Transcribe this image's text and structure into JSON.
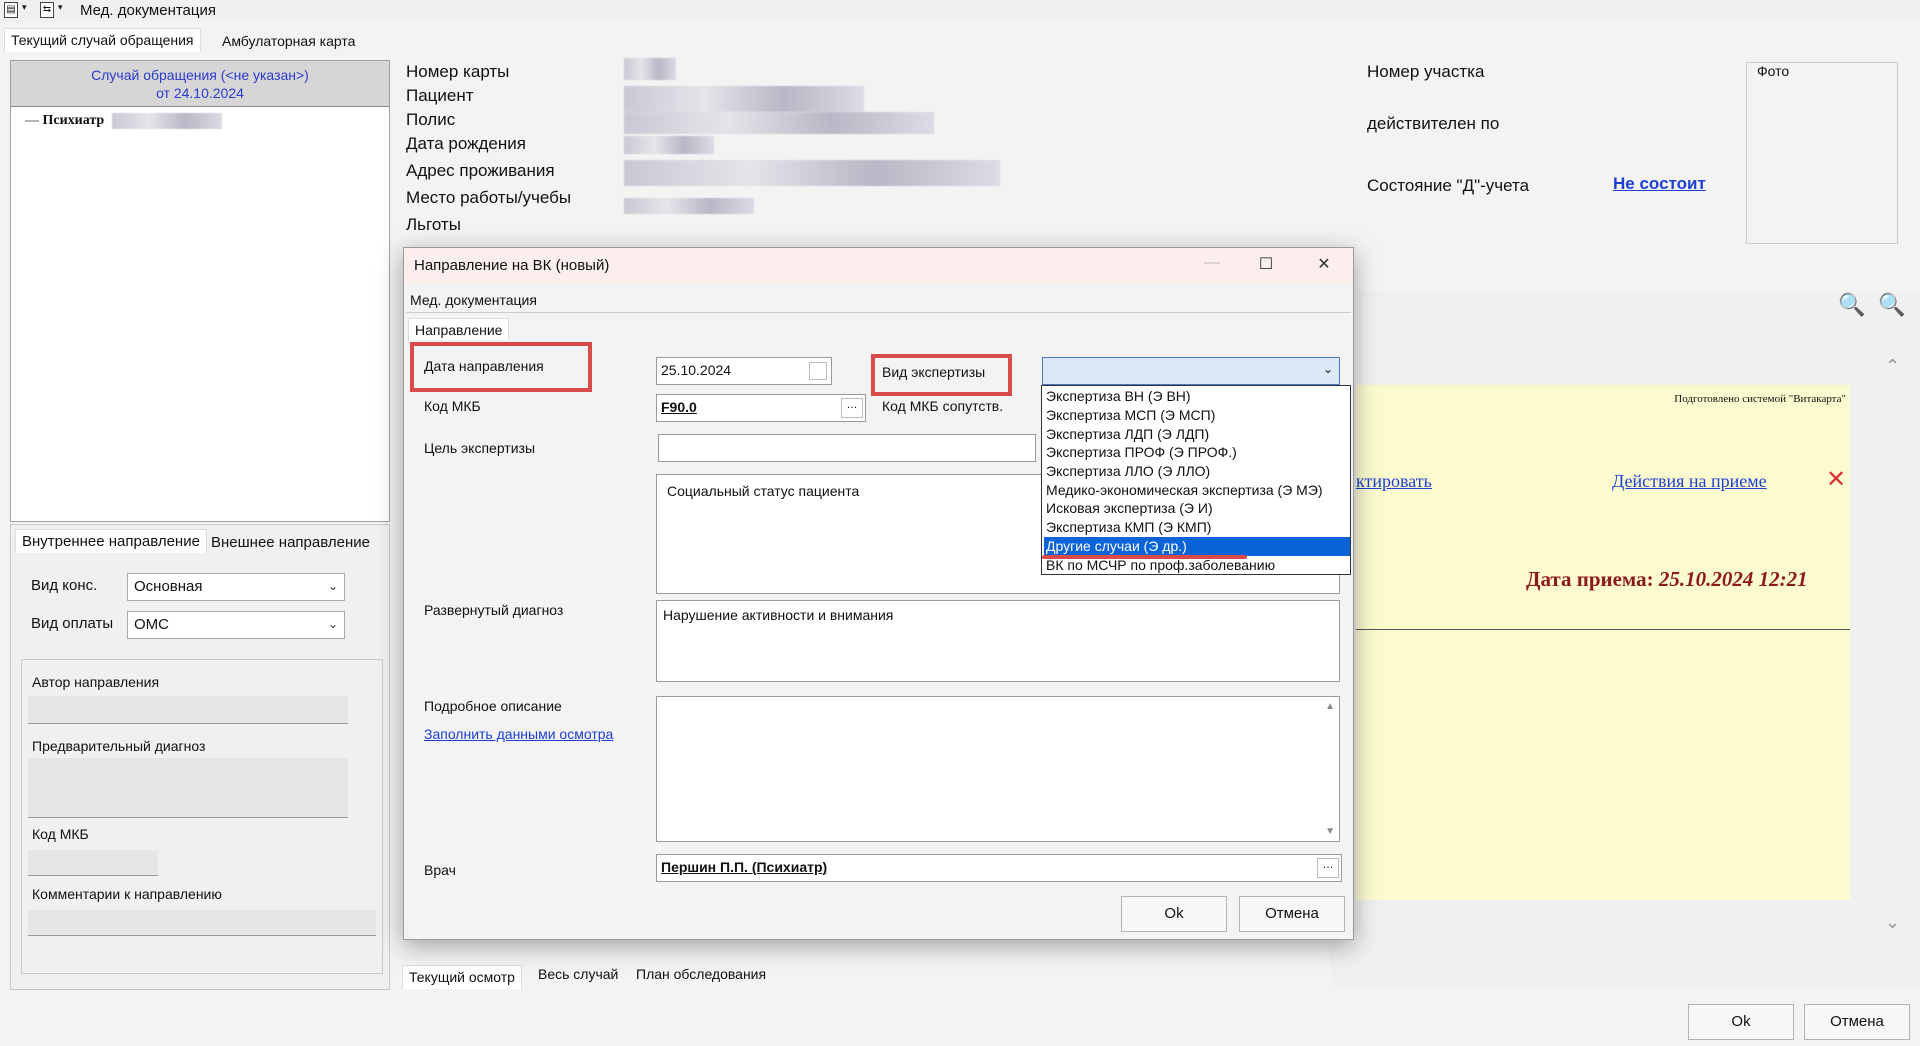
{
  "app": {
    "title": "Мед. документация",
    "tabs": [
      "Текущий случай обращения",
      "Амбулаторная карта"
    ]
  },
  "case": {
    "line1": "Случай обращения (<не указан>)",
    "line2": "от 24.10.2024",
    "tree_item": "Психиатр"
  },
  "left_bottom": {
    "tabs": [
      "Внутреннее направление",
      "Внешнее направление"
    ],
    "vid_kons_label": "Вид конс.",
    "vid_kons_value": "Основная",
    "vid_oplaty_label": "Вид оплаты",
    "vid_oplaty_value": "ОМС",
    "author_label": "Автор направления",
    "prelim_diag_label": "Предварительный диагноз",
    "mkb_label": "Код МКБ",
    "comments_label": "Комментарии к направлению"
  },
  "patient": {
    "labels": [
      "Номер карты",
      "Пациент",
      "Полис",
      "Дата рождения",
      "Адрес проживания",
      "Место работы/учебы",
      "Льготы"
    ],
    "uchastok_label": "Номер участка",
    "valid_label": "действителен по",
    "d_status_label": "Состояние \"Д\"-учета",
    "d_status_value": "Не состоит",
    "photo_label": "Фото"
  },
  "visit": {
    "prepared_by": "Подготовлено системой \"Витакарта\"",
    "edit_link": "ктировать",
    "actions_link": "Действия на приеме",
    "date_label": "Дата приема:",
    "date_value": "25.10.2024 12:21"
  },
  "bottom_tabs": [
    "Текущий осмотр",
    "Весь случай",
    "План обследования"
  ],
  "main_buttons": {
    "ok": "Ok",
    "cancel": "Отмена"
  },
  "modal": {
    "title": "Направление на ВК (новый)",
    "breadcrumb": "Мед. документация",
    "tab": "Направление",
    "date_label": "Дата направления",
    "date_value": "25.10.2024",
    "exp_type_label": "Вид экспертизы",
    "mkb_label": "Код МКБ",
    "mkb_value": "F90.0",
    "mkb_concomitant_label": "Код МКБ сопутств.",
    "goal_label": "Цель экспертизы",
    "social_status": "Социальный статус пациента",
    "ext_diag_label": "Развернутый диагноз",
    "ext_diag_value": "Нарушение активности и внимания",
    "desc_label": "Подробное описание",
    "fill_link": "Заполнить данными осмотра",
    "doctor_label": "Врач",
    "doctor_value": "Першин П.П. (Психиатр)",
    "ok": "Ok",
    "cancel": "Отмена",
    "options": [
      "Экспертиза ВН (Э ВН)",
      "Экспертиза МСП (Э МСП)",
      "Экспертиза ЛДП (Э ЛДП)",
      "Экспертиза ПРОФ (Э ПРОФ.)",
      "Экспертиза ЛЛО (Э ЛЛО)",
      "Медико-экономическая экспертиза (Э МЭ)",
      "Исковая экспертиза (Э И)",
      "Экспертиза КМП (Э КМП)",
      "Другие случаи (Э др.)",
      "ВК по МСЧР по проф.заболеванию"
    ],
    "selected_option": "Другие случаи (Э др.)"
  },
  "colors": {
    "accent_red": "#d94a4a",
    "link_blue": "#1c3fd6",
    "selection_blue": "#0a64d8",
    "visit_date_red": "#8b1a1a"
  }
}
